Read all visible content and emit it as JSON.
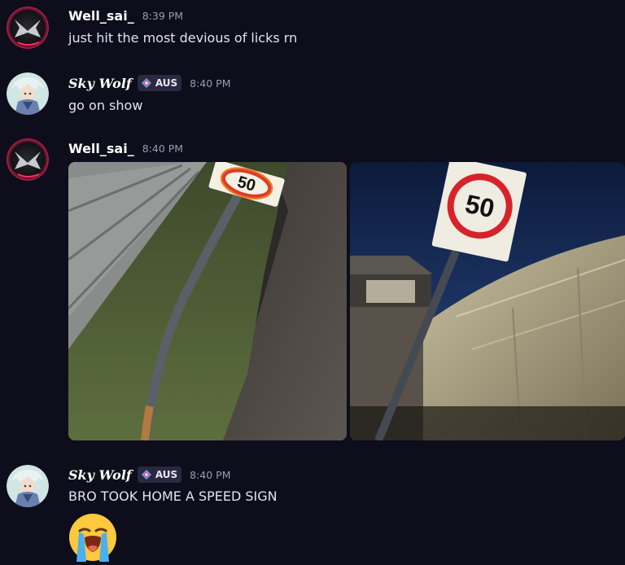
{
  "messages": [
    {
      "author": "Well_sai_",
      "time": "8:39 PM",
      "text": "just hit the most devious of licks rn",
      "avatar": "dark-x-logo-avatar"
    },
    {
      "author": "Sky Wolf",
      "tag": "AUS",
      "time": "8:40 PM",
      "text": "go on show",
      "avatar": "anime-character-avatar"
    },
    {
      "author": "Well_sai_",
      "time": "8:40 PM",
      "attachments": [
        {
          "type": "image",
          "description_icon": "fallen-speed-sign-photo",
          "sign_number": "50"
        },
        {
          "type": "image",
          "description_icon": "speed-sign-at-home-photo",
          "sign_number": "50"
        }
      ]
    },
    {
      "author": "Sky Wolf",
      "tag": "AUS",
      "time": "8:40 PM",
      "text": "BRO TOOK HOME A SPEED SIGN",
      "emoji": "loudly-crying-face"
    }
  ],
  "colors": {
    "background": "#0e0d1b",
    "username": "#ffffff",
    "timestamp": "#9a9ab4",
    "tag_bg": "#2a2940",
    "avatar_accent": "#c41c4a"
  }
}
